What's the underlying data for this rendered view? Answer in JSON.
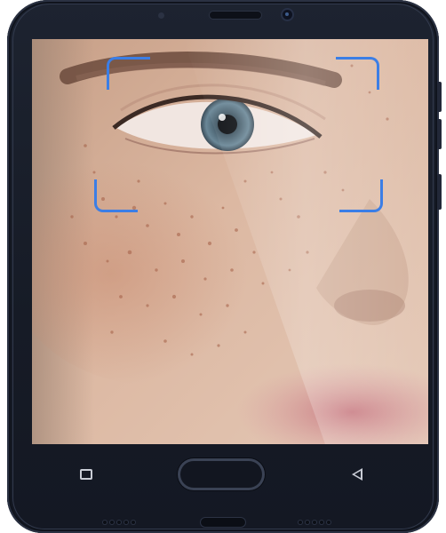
{
  "device": {
    "type": "smartphone",
    "color": "#1a1f2b",
    "accent_scan_color": "#3b7ee6"
  },
  "screen": {
    "content": "face-scan",
    "scan_frame_icon": "face-scan-frame-icon"
  },
  "navigation": {
    "recent_icon": "square-recent-apps-icon",
    "home_icon": "fingerprint-home-button",
    "back_icon": "triangle-back-icon"
  }
}
